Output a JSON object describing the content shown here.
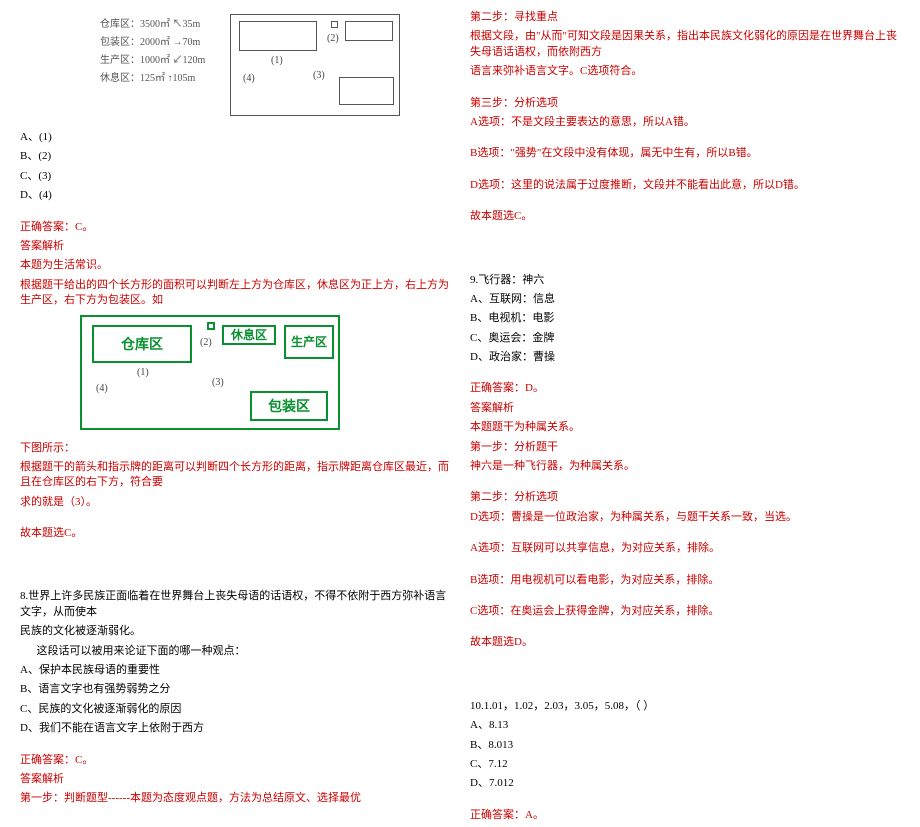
{
  "legend": {
    "row1": "仓库区：3500㎡  ↖35m",
    "row2": "包装区：2000㎡  →70m",
    "row3": "生产区：1000㎡  ↙120m",
    "row4": "休息区：125㎡  ↑105m"
  },
  "topDiag": {
    "n1": "(1)",
    "n2": "(2)",
    "n3": "(3)",
    "n4": "(4)"
  },
  "q7": {
    "optA": "A、(1)",
    "optB": "B、(2)",
    "optC": "C、(3)",
    "optD": "D、(4)",
    "ans": "正确答案：C。",
    "expTitle": "答案解析",
    "exp1": "本题为生活常识。",
    "exp2": "根据题干给出的四个长方形的面积可以判断左上方为仓库区，休息区为正上方，右上方为生产区，右下方为包装区。如"
  },
  "green": {
    "ck": "仓库区",
    "xx": "休息区",
    "sc": "生产区",
    "bz": "包装区",
    "n1": "(1)",
    "n2": "(2)",
    "n3": "(3)",
    "n4": "(4)"
  },
  "q7b": {
    "below": "下图所示：",
    "exp3": "根据题干的箭头和指示牌的距离可以判断四个长方形的距离，指示牌距离仓库区最近，而且在仓库区的右下方，符合要",
    "exp3b": "求的就是（3）。",
    "exp4": "故本题选C。"
  },
  "q8": {
    "stem1": "8.世界上许多民族正面临着在世界舞台上丧失母语的话语权，不得不依附于西方弥补语言文字，从而使本",
    "stem2": "民族的文化被逐渐弱化。",
    "stem3": "这段话可以被用来论证下面的哪一种观点：",
    "optA": "A、保护本民族母语的重要性",
    "optB": "B、语言文字也有强势弱势之分",
    "optC": "C、民族的文化被逐渐弱化的原因",
    "optD": "D、我们不能在语言文字上依附于西方",
    "ans": "正确答案：C。",
    "expTitle": "答案解析",
    "exp1": "第一步：判断题型------本题为态度观点题，方法为总结原文、选择最优"
  },
  "q8r": {
    "step2": "第二步：寻找重点",
    "step2a": "根据文段，由\"从而\"可知文段是因果关系，指出本民族文化弱化的原因是在世界舞台上丧失母语话语权，而依附西方",
    "step2b": "语言来弥补语言文字。C选项符合。",
    "step3": "第三步：分析选项",
    "step3a": "A选项：不是文段主要表达的意思，所以A错。",
    "step3b": "B选项：\"强势\"在文段中没有体现，属无中生有，所以B错。",
    "step3d": "D选项：这里的说法属于过度推断，文段并不能看出此意，所以D错。",
    "step3e": "故本题选C。"
  },
  "q9": {
    "stem": "9.飞行器：神六",
    "optA": "A、互联网：信息",
    "optB": "B、电视机：电影",
    "optC": "C、奥运会：金牌",
    "optD": "D、政治家：曹操",
    "ans": "正确答案：D。",
    "expTitle": "答案解析",
    "exp1": "本题题干为种属关系。",
    "exp2": "第一步：分析题干",
    "exp3": "神六是一种飞行器，为种属关系。",
    "step2": "第二步：分析选项",
    "optDexp": "D选项：曹操是一位政治家，为种属关系，与题干关系一致，当选。",
    "optAexp": "A选项：互联网可以共享信息，为对应关系，排除。",
    "optBexp": "B选项：用电视机可以看电影，为对应关系，排除。",
    "optCexp": "C选项：在奥运会上获得金牌，为对应关系，排除。",
    "final": "故本题选D。"
  },
  "q10": {
    "stem": "10.1.01，1.02，2.03，3.05，5.08，（    ）",
    "optA": "A、8.13",
    "optB": "B、8.013",
    "optC": "C、7.12",
    "optD": "D、7.012",
    "ans": "正确答案：A。"
  }
}
